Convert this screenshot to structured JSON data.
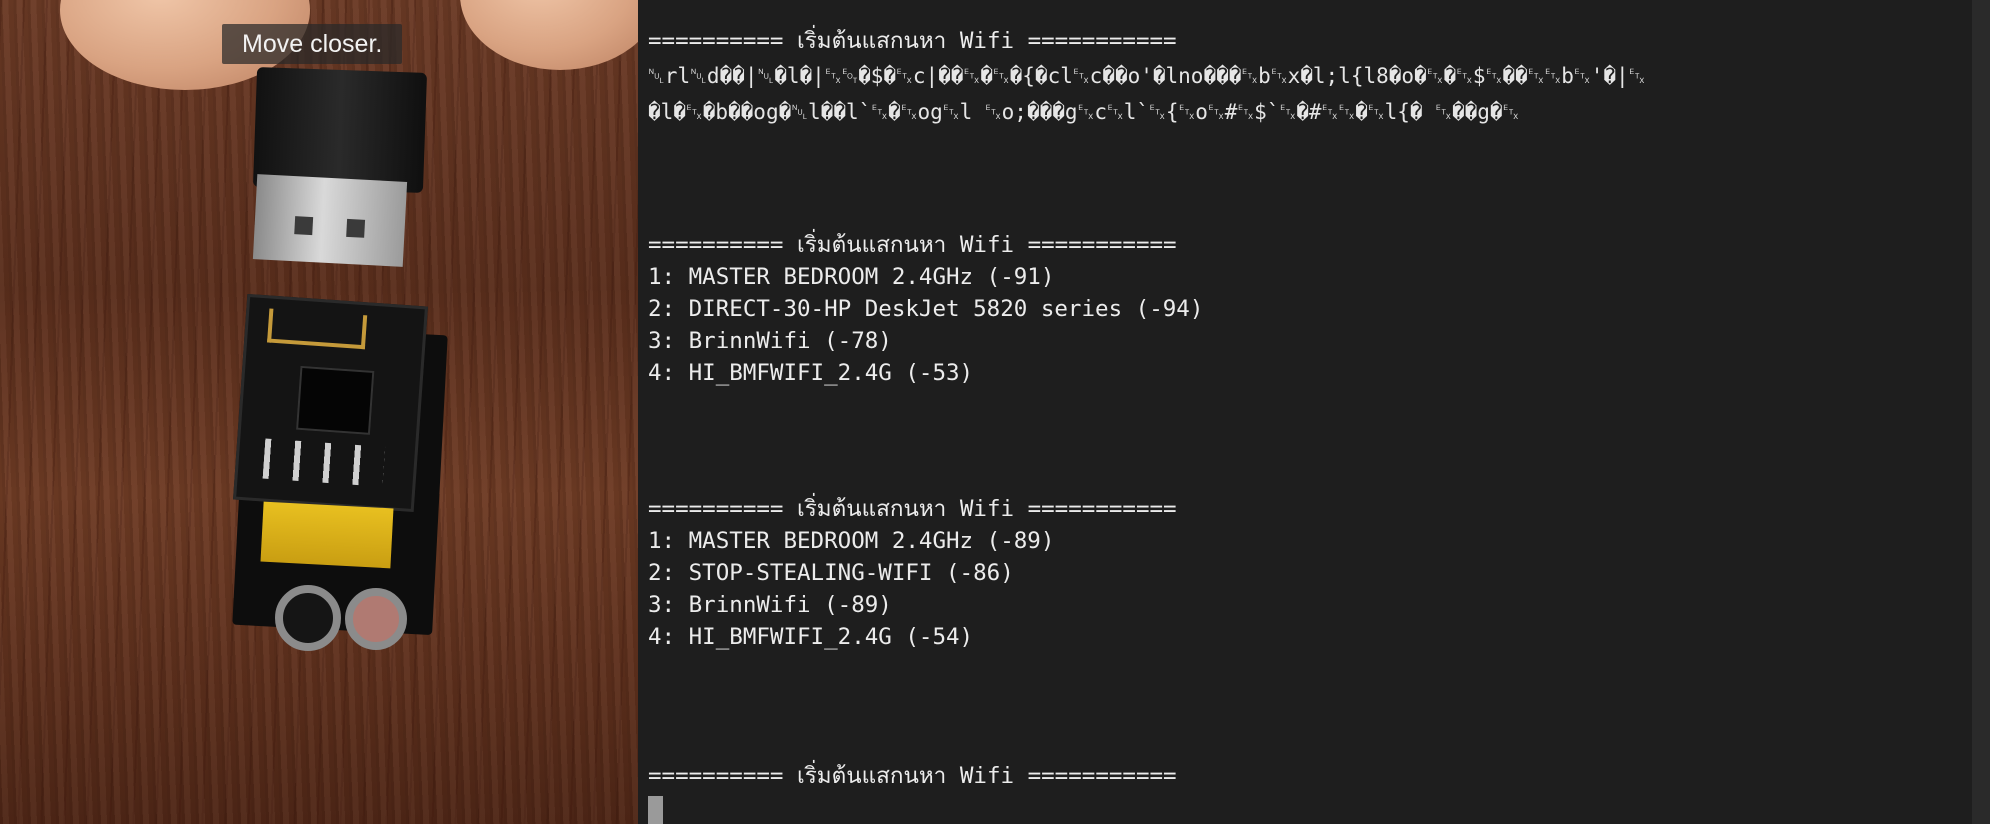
{
  "camera": {
    "hint": "Move closer."
  },
  "terminal": {
    "lines": [
      "========== เริ่มต้นแสกนหา Wifi ===========",
      "␀rl␀d��|␀�l�|␃␄�$�␃c|��␃�␃�{�cl␃c��o'�lno���␃b␃x�l;l{l8�o�␃�␃$␃��␃␃b␃'�|␃",
      "�l�␃�b��og�␀l��l`␃�␃og␃l ␃o;���g␃c␃l`␃{␃o␃#␃$`␃�#␃␃�␃l{� ␃��g�␃",
      "",
      "",
      "========== เริ่มต้นแสกนหา Wifi ===========",
      "1: MASTER BEDROOM 2.4GHz (-91)",
      "2: DIRECT-30-HP DeskJet 5820 series (-94)",
      "3: BrinnWifi (-78)",
      "4: HI_BMFWIFI_2.4G (-53)",
      "",
      "",
      "",
      "========== เริ่มต้นแสกนหา Wifi ===========",
      "1: MASTER BEDROOM 2.4GHz (-89)",
      "2: STOP-STEALING-WIFI (-86)",
      "3: BrinnWifi (-89)",
      "4: HI_BMFWIFI_2.4G (-54)",
      "",
      "",
      "",
      "========== เริ่มต้นแสกนหา Wifi ==========="
    ]
  }
}
